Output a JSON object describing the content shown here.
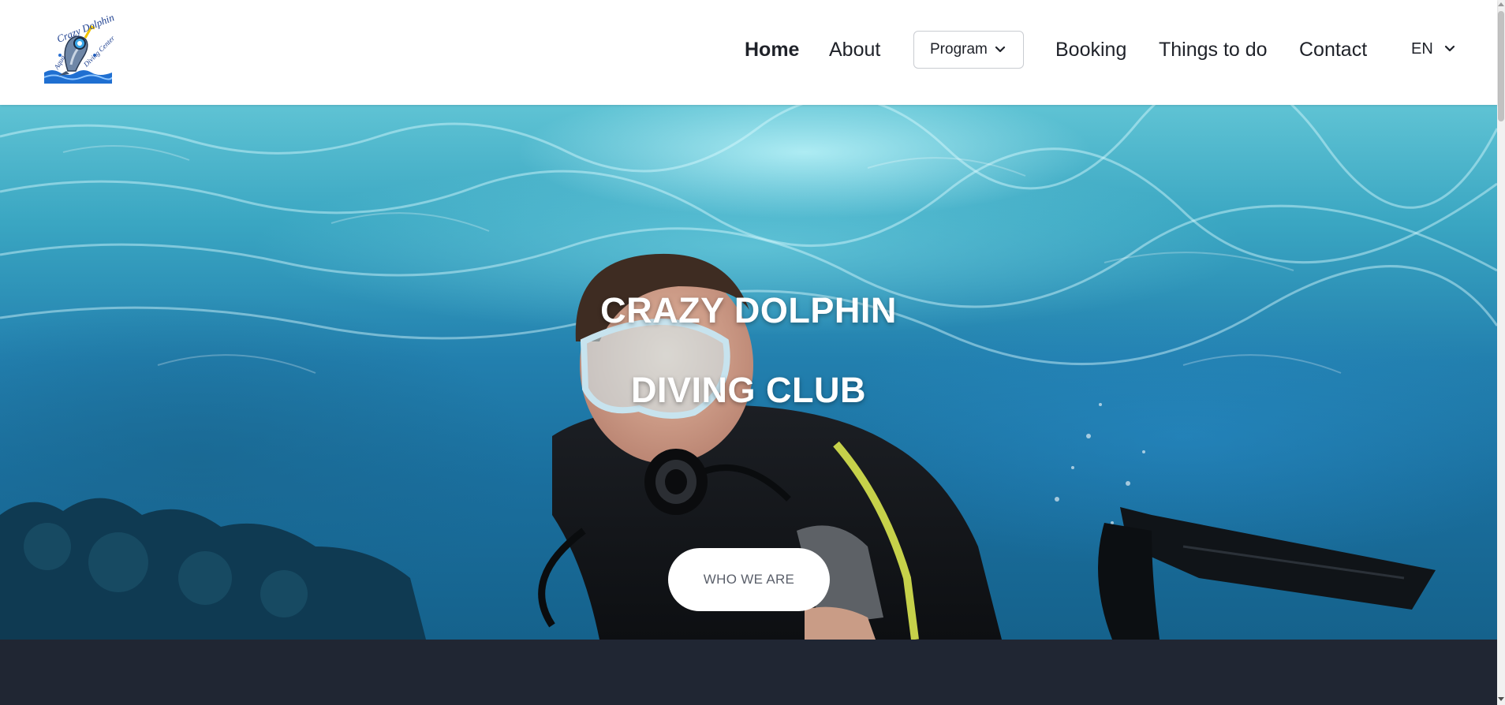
{
  "header": {
    "logo": {
      "alt_text_top": "Crazy Dolphin",
      "alt_text_side_left": "Aqua",
      "alt_text_side_right": "Diving Center"
    },
    "nav": {
      "home": "Home",
      "about": "About",
      "program": "Program",
      "booking": "Booking",
      "things_to_do": "Things to do",
      "contact": "Contact"
    },
    "language": "EN"
  },
  "hero": {
    "title_line1": "CRAZY DOLPHIN",
    "title_line2": "DIVING CLUB",
    "cta_label": "WHO WE ARE"
  },
  "colors": {
    "text_dark": "#1f2229",
    "dark_section": "#202633",
    "water_light": "#5fc3d4",
    "water_deep": "#15628c"
  },
  "icons": [
    "dolphin-logo-icon",
    "chevron-down-icon"
  ]
}
